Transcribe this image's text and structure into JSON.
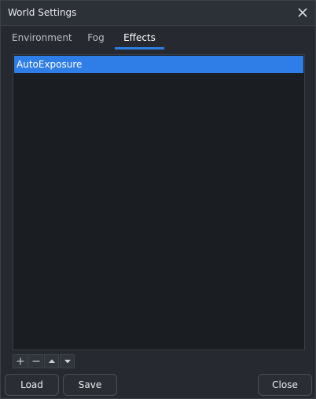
{
  "window": {
    "title": "World Settings",
    "close_icon": "close-icon"
  },
  "tabs": [
    {
      "label": "Environment",
      "active": false
    },
    {
      "label": "Fog",
      "active": false
    },
    {
      "label": "Effects",
      "active": true
    }
  ],
  "effects_list": {
    "items": [
      {
        "label": "AutoExposure",
        "selected": true
      }
    ]
  },
  "list_toolbar": {
    "icons": [
      "plus-icon",
      "minus-icon",
      "arrow-up-icon",
      "arrow-down-icon"
    ]
  },
  "footer": {
    "load_label": "Load",
    "save_label": "Save",
    "close_label": "Close"
  },
  "colors": {
    "accent": "#2f7de6",
    "background": "#262a30",
    "list_background": "#1a1d21"
  }
}
